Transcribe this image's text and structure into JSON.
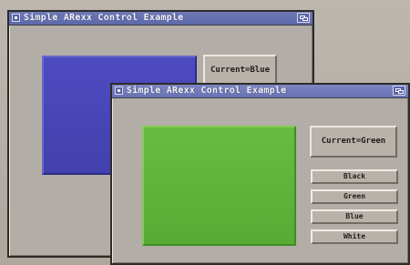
{
  "windows": {
    "background": {
      "title": "Simple ARexx Control Example",
      "status": "Current=Blue",
      "panel_color": "#4a48ba"
    },
    "foreground": {
      "title": "Simple ARexx Control Example",
      "status": "Current=Green",
      "panel_color": "#62b63d",
      "buttons": {
        "black": "Black",
        "green": "Green",
        "blue": "Blue",
        "white": "White"
      }
    }
  },
  "icons": {
    "close": "close-gadget-icon",
    "depth": "depth-gadget-icon"
  },
  "colors": {
    "titlebar": "#6670b2",
    "window_body": "#b2ada6",
    "button_face": "#b8b2aa",
    "text_dark": "#1f1c1a",
    "blue_swatch": "#4a48ba",
    "green_swatch": "#62b63d"
  }
}
